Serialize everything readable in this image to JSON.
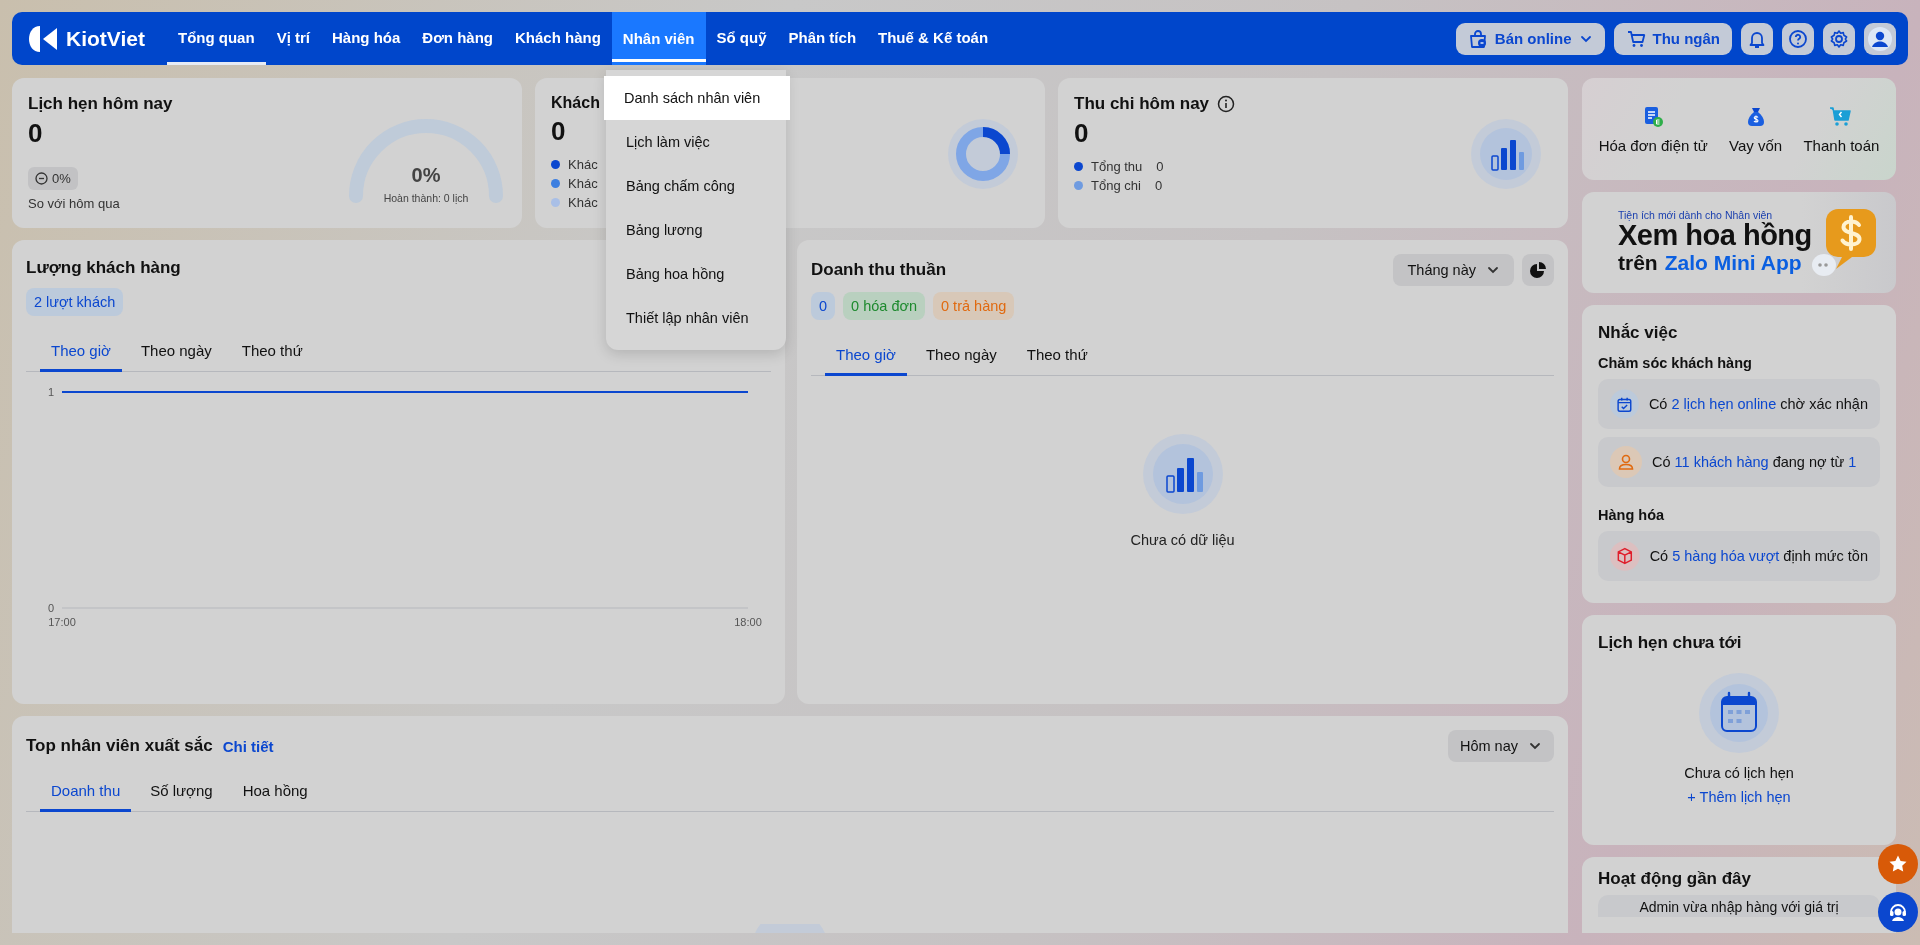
{
  "nav": {
    "logo": "KiotViet",
    "items": [
      {
        "label": "Tổng quan",
        "selected": true,
        "open": false
      },
      {
        "label": "Vị trí",
        "selected": false,
        "open": false
      },
      {
        "label": "Hàng hóa",
        "selected": false,
        "open": false
      },
      {
        "label": "Đơn hàng",
        "selected": false,
        "open": false
      },
      {
        "label": "Khách hàng",
        "selected": false,
        "open": false
      },
      {
        "label": "Nhân viên",
        "selected": false,
        "open": true
      },
      {
        "label": "Sổ quỹ",
        "selected": false,
        "open": false
      },
      {
        "label": "Phân tích",
        "selected": false,
        "open": false
      },
      {
        "label": "Thuế & Kế toán",
        "selected": false,
        "open": false
      }
    ],
    "online_button": "Bán online",
    "cashier_button": "Thu ngân"
  },
  "staff_menu": {
    "items": [
      {
        "label": "Danh sách nhân viên",
        "selected": true
      },
      {
        "label": "Lịch làm việc",
        "selected": false
      },
      {
        "label": "Bảng chấm công",
        "selected": false
      },
      {
        "label": "Bảng lương",
        "selected": false
      },
      {
        "label": "Bảng hoa hồng",
        "selected": false
      },
      {
        "label": "Thiết lập nhân viên",
        "selected": false
      }
    ]
  },
  "appointments_today": {
    "title": "Lịch hẹn hôm nay",
    "value": "0",
    "change": "0%",
    "compare_label": "So với hôm qua",
    "gauge": {
      "percent": "0%",
      "caption": "Hoàn thành: 0 lịch"
    }
  },
  "customers_today": {
    "title": "Khách",
    "value": "0",
    "legend": [
      {
        "label": "Khác",
        "color": "#0b47cf"
      },
      {
        "label": "Khác",
        "color": "#3d7fe0"
      },
      {
        "label": "Khác",
        "color": "#a9bfe6"
      }
    ]
  },
  "cash_today": {
    "title": "Thu chi hôm nay",
    "value": "0",
    "legend": [
      {
        "label": "Tổng thu",
        "value": "0",
        "color": "#0b47cf"
      },
      {
        "label": "Tổng chi",
        "value": "0",
        "color": "#6f9be0"
      }
    ]
  },
  "customer_traffic": {
    "title": "Lượng khách hàng",
    "badge": "2 lượt khách",
    "tabs": [
      {
        "label": "Theo giờ",
        "selected": true
      },
      {
        "label": "Theo ngày",
        "selected": false
      },
      {
        "label": "Theo thứ",
        "selected": false
      }
    ],
    "chart_data": {
      "type": "line",
      "categories": [
        "17:00",
        "18:00"
      ],
      "series": [
        {
          "color": "#0b47cf",
          "values": [
            1,
            1
          ]
        }
      ],
      "yticks": [
        0,
        1
      ],
      "ylim": [
        0,
        1
      ]
    }
  },
  "net_revenue": {
    "title": "Doanh thu thuần",
    "period": "Tháng này",
    "badges": [
      {
        "text": "0",
        "kind": "total"
      },
      {
        "text": "0 hóa đơn",
        "kind": "invoices"
      },
      {
        "text": "0 trả hàng",
        "kind": "returns"
      }
    ],
    "tabs": [
      {
        "label": "Theo giờ",
        "selected": true
      },
      {
        "label": "Theo ngày",
        "selected": false
      },
      {
        "label": "Theo thứ",
        "selected": false
      }
    ],
    "empty_text": "Chưa có dữ liệu"
  },
  "top_staff": {
    "title": "Top nhân viên xuất sắc",
    "link": "Chi tiết",
    "period": "Hôm nay",
    "tabs": [
      {
        "label": "Doanh thu",
        "selected": true
      },
      {
        "label": "Số lượng",
        "selected": false
      },
      {
        "label": "Hoa hồng",
        "selected": false
      }
    ]
  },
  "shortcuts": [
    {
      "label": "Hóa đơn điện tử",
      "kind": "invoice"
    },
    {
      "label": "Vay vốn",
      "kind": "loan"
    },
    {
      "label": "Thanh toán",
      "kind": "payment"
    }
  ],
  "promo_banner": {
    "eyebrow": "Tiện ích mới dành cho Nhân viên",
    "headline": "Xem hoa hồng",
    "subline": "trên",
    "highlight": "Zalo Mini App"
  },
  "reminders": {
    "title": "Nhắc việc",
    "groups": [
      {
        "title": "Chăm sóc khách hàng",
        "items": [
          {
            "kind": "appointment",
            "parts": [
              {
                "text": "Có",
                "link": false
              },
              {
                "text": "2 lịch hẹn online",
                "link": true
              },
              {
                "text": "chờ xác nhận",
                "link": false
              }
            ]
          },
          {
            "kind": "customer",
            "parts": [
              {
                "text": "Có",
                "link": false
              },
              {
                "text": "11 khách hàng",
                "link": true
              },
              {
                "text": "đang nợ từ",
                "link": false
              },
              {
                "text": "1",
                "link": true
              }
            ]
          }
        ]
      },
      {
        "title": "Hàng hóa",
        "items": [
          {
            "kind": "product",
            "parts": [
              {
                "text": "Có",
                "link": false
              },
              {
                "text": "5 hàng hóa vượt",
                "link": true
              },
              {
                "text": "định mức tồn",
                "link": false
              }
            ]
          }
        ]
      }
    ]
  },
  "upcoming": {
    "title": "Lịch hẹn chưa tới",
    "empty_text": "Chưa có lịch hẹn",
    "add_link": "+ Thêm lịch hẹn"
  },
  "recent_activity": {
    "title": "Hoạt động gần đây",
    "items": [
      "Admin vừa nhập hàng với giá trị"
    ]
  }
}
